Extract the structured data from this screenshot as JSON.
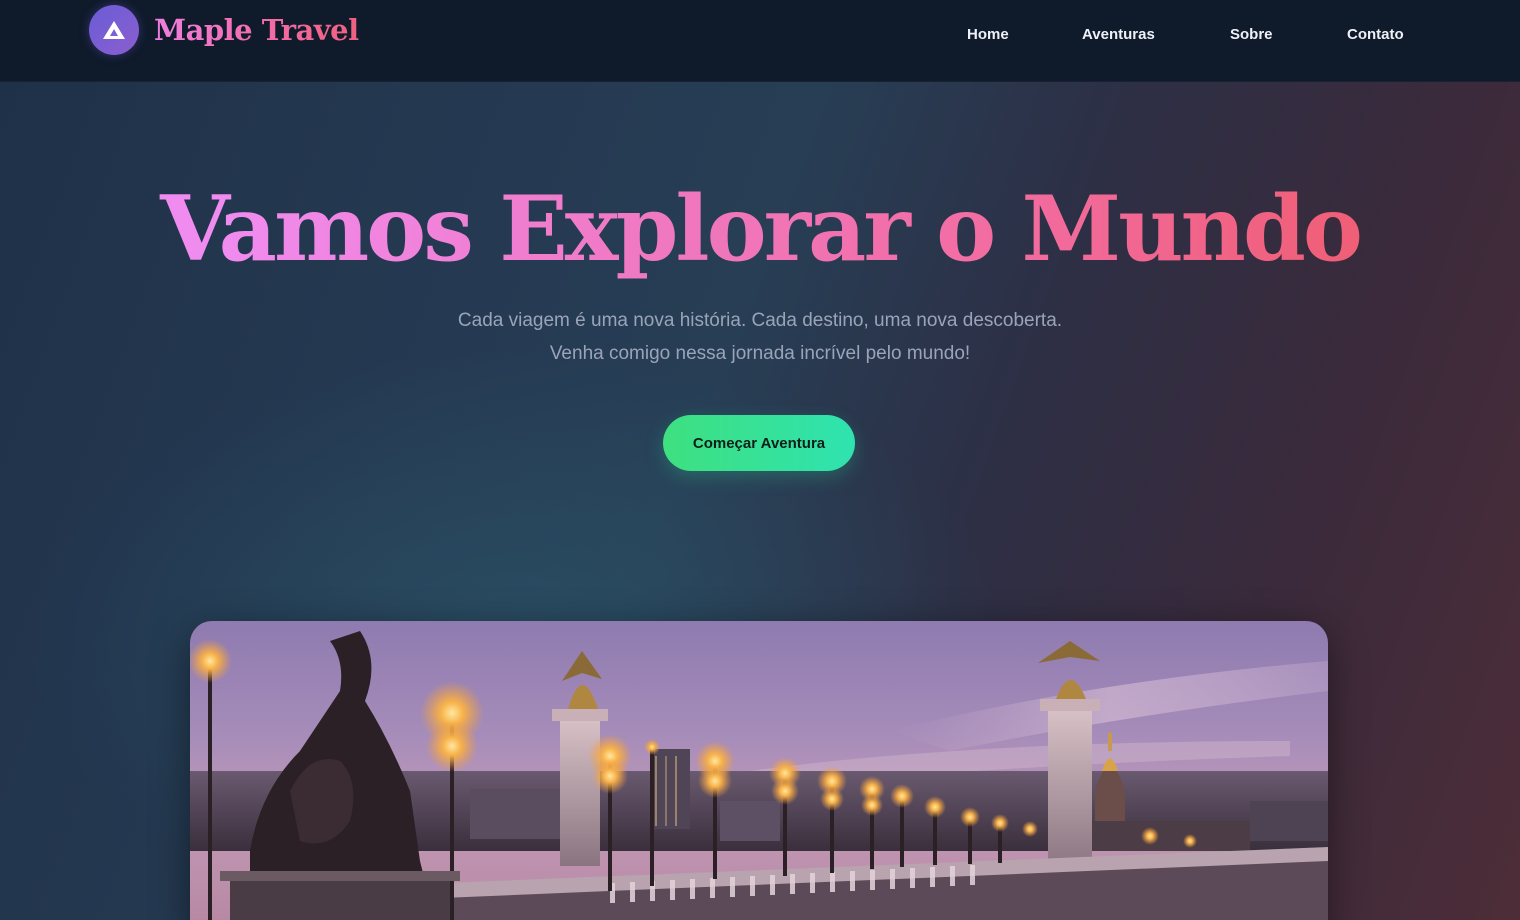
{
  "header": {
    "brand_name": "Maple Travel",
    "logo_icon": "mountain-icon",
    "nav": {
      "home": "Home",
      "adventures": "Aventuras",
      "about": "Sobre",
      "contact": "Contato"
    }
  },
  "hero": {
    "title": "Vamos Explorar o Mundo",
    "subtitle": "Cada viagem é uma nova história. Cada destino, uma nova descoberta. Venha comigo nessa jornada incrível pelo mundo!",
    "cta_label": "Começar Aventura"
  },
  "colors": {
    "navbar_bg": "#0f1a2b",
    "brand_gradient": [
      "#ee7fe0",
      "#f0607e"
    ],
    "cta_gradient": [
      "#3ee07f",
      "#2fe3b0"
    ],
    "subtitle_text": "#9aa4b8"
  }
}
